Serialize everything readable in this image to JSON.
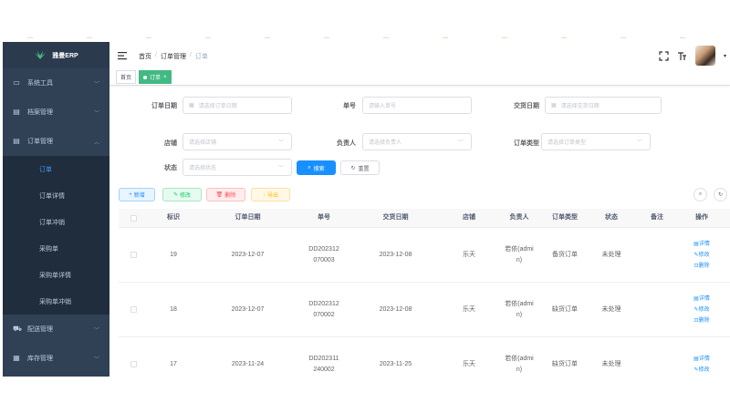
{
  "app": {
    "logo_text": "雅曼ERP"
  },
  "sidebar": {
    "items": [
      {
        "label": "系统工具",
        "icon": "monitor-icon"
      },
      {
        "label": "档案管理",
        "icon": "document-icon"
      },
      {
        "label": "订单管理",
        "icon": "document-icon",
        "expanded": true
      },
      {
        "label": "配送管理",
        "icon": "truck-icon"
      },
      {
        "label": "库存管理",
        "icon": "grid-icon"
      }
    ],
    "subitems": [
      {
        "label": "订单",
        "active": true
      },
      {
        "label": "订单详情"
      },
      {
        "label": "订单冲销"
      },
      {
        "label": "采购单"
      },
      {
        "label": "采购单详情"
      },
      {
        "label": "采购单冲销"
      }
    ]
  },
  "breadcrumb": {
    "home": "首页",
    "section": "订单管理",
    "current": "订单",
    "sep": "/"
  },
  "tags": {
    "home": "首页",
    "active": "订单",
    "close": "×"
  },
  "search": {
    "order_date_label": "订单日期",
    "order_date_placeholder": "请选择订单日期",
    "order_no_label": "单号",
    "order_no_placeholder": "请输入单号",
    "delivery_date_label": "交货日期",
    "delivery_date_placeholder": "请选择交货日期",
    "shop_label": "店铺",
    "shop_placeholder": "请选择店铺",
    "owner_label": "负责人",
    "owner_placeholder": "请选择负责人",
    "type_label": "订单类型",
    "type_placeholder": "请选择订单类型",
    "status_label": "状态",
    "status_placeholder": "请选择状态",
    "search_btn": "搜索",
    "reset_btn": "重置"
  },
  "toolbar": {
    "add": "新增",
    "edit": "修改",
    "delete": "删除",
    "export": "导出"
  },
  "table": {
    "columns": [
      "标识",
      "订单日期",
      "单号",
      "交货日期",
      "店铺",
      "负责人",
      "订单类型",
      "状态",
      "备注",
      "操作"
    ],
    "rows": [
      {
        "id": "19",
        "order_date": "2023-12-07",
        "no_line1": "DD202312",
        "no_line2": "070003",
        "delivery_date": "2023-12-08",
        "shop": "乐天",
        "owner_line1": "若依(admi",
        "owner_line2": "n)",
        "type": "备货订单",
        "status": "未处理",
        "remark": ""
      },
      {
        "id": "18",
        "order_date": "2023-12-07",
        "no_line1": "DD202312",
        "no_line2": "070002",
        "delivery_date": "2023-12-08",
        "shop": "乐天",
        "owner_line1": "若依(admi",
        "owner_line2": "n)",
        "type": "缺货订单",
        "status": "未处理",
        "remark": ""
      },
      {
        "id": "17",
        "order_date": "2023-11-24",
        "no_line1": "DD202311",
        "no_line2": "240002",
        "delivery_date": "2023-11-25",
        "shop": "乐天",
        "owner_line1": "若依(admi",
        "owner_line2": "n)",
        "type": "缺货订单",
        "status": "未处理",
        "remark": ""
      }
    ],
    "op_detail": "详情",
    "op_edit": "修改",
    "op_delete": "删除"
  },
  "colors": {
    "sidebar": "#304156",
    "primary": "#1890ff",
    "tag_active": "#42b983"
  }
}
